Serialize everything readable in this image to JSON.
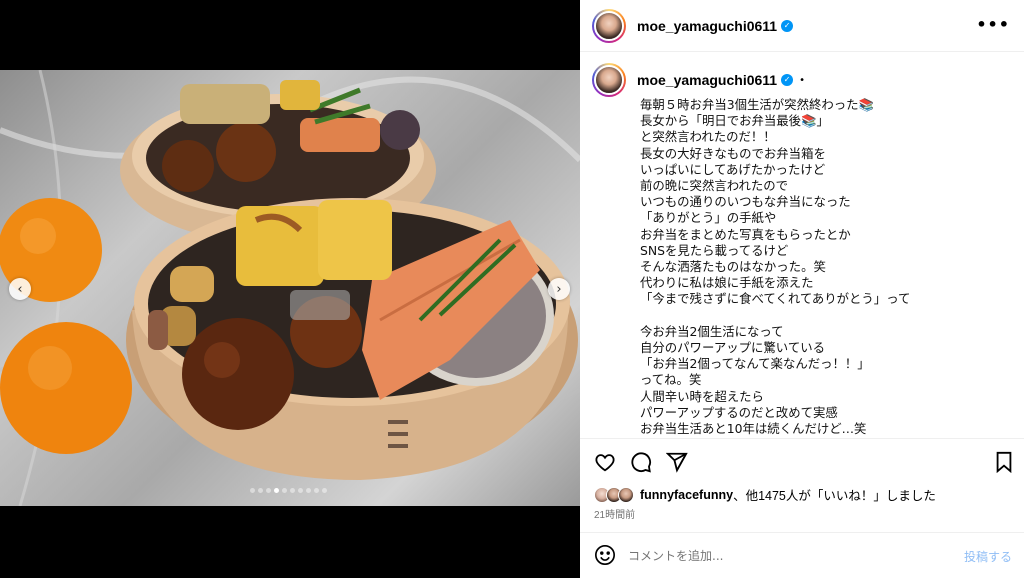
{
  "post": {
    "username": "moe_yamaguchi0611",
    "more_icon": "more-horizontal-icon",
    "caption": "毎朝５時お弁当3個生活が突然終わった📚\n長女から「明日でお弁当最後📚」\nと突然言われたのだ！！\n長女の大好きなものでお弁当箱を\nいっぱいにしてあげたかったけど\n前の晩に突然言われたので\nいつもの通りのいつもな弁当になった\n「ありがとう」の手紙や\nお弁当をまとめた写真をもらったとか\nSNSを見たら載ってるけど\nそんな洒落たものはなかった。笑\n代わりに私は娘に手紙を添えた\n「今まで残さずに食べてくれてありがとう」って\n\n今お弁当2個生活になって\n自分のパワーアップに驚いている\n「お弁当2個ってなんて楽なんだっ！！」\nってね。笑\n人間辛い時を超えたら\nパワーアップするのだと改めて実感\nお弁当生活あと10年は続くんだけど…笑",
    "bullet": "•",
    "likes_users": "funnyfacefunny",
    "likes_rest": "、他1475人が「いいね！」しました",
    "time_ago": "21時間前"
  },
  "media": {
    "prev_icon": "chevron-left-icon",
    "next_icon": "chevron-right-icon",
    "prev_glyph": "‹",
    "next_glyph": "›",
    "carousel_total": 10,
    "carousel_active": 4
  },
  "actions": {
    "like_icon": "heart-icon",
    "comment_icon": "comment-icon",
    "share_icon": "share-icon",
    "save_icon": "bookmark-icon"
  },
  "comment": {
    "placeholder": "コメントを追加...",
    "post_label": "投稿する",
    "emoji_icon": "emoji-icon"
  }
}
